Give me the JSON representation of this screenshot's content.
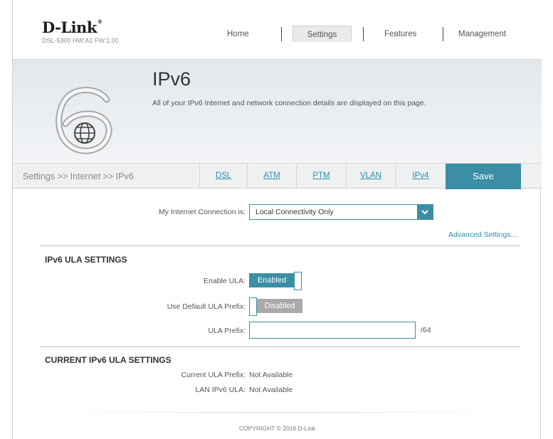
{
  "brand": {
    "logo": "D-Link",
    "model": "DSL-5300 HW:A1 FW:1.00"
  },
  "nav": {
    "home": "Home",
    "settings": "Settings",
    "features": "Features",
    "management": "Management"
  },
  "banner": {
    "title": "IPv6",
    "description": "All of your IPv6 Internet and network connection details are displayed on this page."
  },
  "tabbar": {
    "breadcrumb": "Settings >> Internet >> IPv6",
    "tabs": [
      "DSL",
      "ATM",
      "PTM",
      "VLAN",
      "IPv4"
    ],
    "save": "Save"
  },
  "connection": {
    "label": "My Internet Connection is:",
    "value": "Local Connectivity Only",
    "advanced": "Advanced Settings..."
  },
  "ula": {
    "section": "IPv6 ULA SETTINGS",
    "enable_label": "Enable ULA:",
    "enable_state": "Enabled",
    "default_prefix_label": "Use Default ULA Prefix:",
    "default_prefix_state": "Disabled",
    "prefix_label": "ULA Prefix:",
    "prefix_value": "",
    "prefix_suffix": "/64"
  },
  "current": {
    "section": "CURRENT IPv6 ULA SETTINGS",
    "prefix_label": "Current ULA Prefix:",
    "prefix_value": "Not Available",
    "lan_label": "LAN IPv6 ULA:",
    "lan_value": "Not Available"
  },
  "footer": {
    "copyright": "COPYRIGHT © 2016 D-Link"
  },
  "colors": {
    "accent": "#3b8ea5",
    "link": "#2e8fa8",
    "disabled": "#a9a9a9"
  },
  "icons": {
    "page": "ipv6-globe-lock-icon",
    "dropdown": "chevron-down-icon"
  }
}
